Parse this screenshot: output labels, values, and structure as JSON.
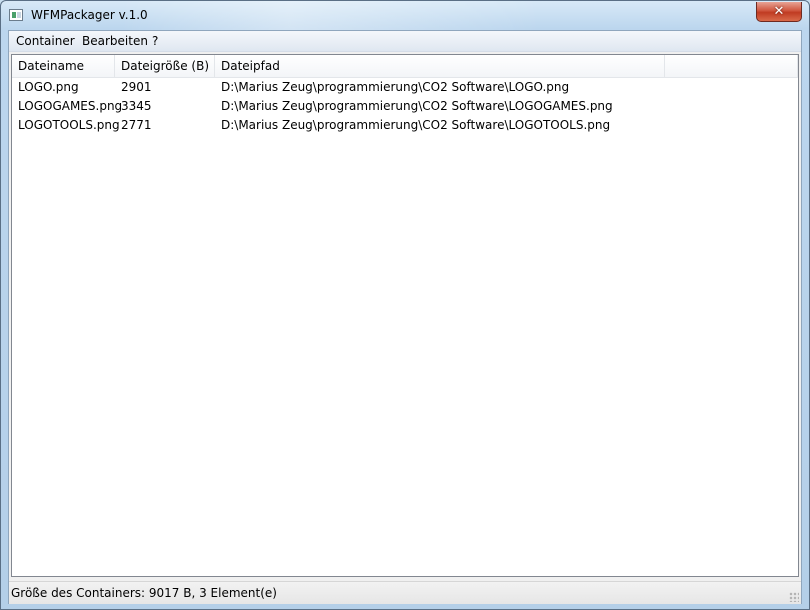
{
  "window": {
    "title": "WFMPackager v.1.0",
    "close_label": "✕"
  },
  "menu": {
    "items": [
      "Container",
      "Bearbeiten",
      "?"
    ]
  },
  "list": {
    "columns": [
      "Dateiname",
      "Dateigröße (B)",
      "Dateipfad",
      ""
    ],
    "rows": [
      {
        "name": "LOGO.png",
        "size": "2901",
        "path": "D:\\Marius Zeug\\programmierung\\CO2 Software\\LOGO.png"
      },
      {
        "name": "LOGOGAMES.png",
        "size": "3345",
        "path": "D:\\Marius Zeug\\programmierung\\CO2 Software\\LOGOGAMES.png"
      },
      {
        "name": "LOGOTOOLS.png",
        "size": "2771",
        "path": "D:\\Marius Zeug\\programmierung\\CO2 Software\\LOGOTOOLS.png"
      }
    ]
  },
  "status": {
    "text": "Größe des Containers: 9017 B, 3 Element(e)"
  },
  "colors": {
    "close_button": "#c7432a",
    "titlebar": "#bcd6ee"
  }
}
